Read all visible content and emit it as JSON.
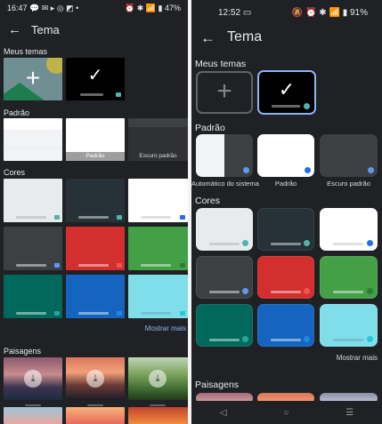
{
  "left": {
    "status": {
      "time": "16:47",
      "left_icons": "💬 ✉ ▸ ◎ ◩ •",
      "right_icons": "⏰ ✱ 📶 ▮",
      "battery": "47%"
    },
    "appbar": {
      "back": "←",
      "title": "Tema"
    },
    "sections": {
      "my_themes": "Meus temas",
      "default": "Padrão",
      "colors": "Cores",
      "landscapes": "Paisagens"
    },
    "default_labels": [
      "Automático do sistema",
      "Padrão",
      "Escuro padrão"
    ],
    "more": "Mostrar mais",
    "download_glyph": "⤓"
  },
  "right": {
    "status": {
      "time": "12:52",
      "left_icons": "▭",
      "right_icons": "🔕 ⏰ ✱ 📶 ▮",
      "battery": "91%"
    },
    "appbar": {
      "back": "←",
      "title": "Tema"
    },
    "sections": {
      "my_themes": "Meus temas",
      "default": "Padrão",
      "colors": "Cores",
      "landscapes": "Paisagens"
    },
    "default_labels": [
      "Automático do sistema",
      "Padrão",
      "Escuro padrão"
    ],
    "more": "Mostrar mais",
    "nav": {
      "back": "◁",
      "home": "○",
      "menu": "☰"
    }
  },
  "plus_glyph": "+",
  "check_glyph": "✓",
  "colors": {
    "accent_link": "#8ab4f8",
    "color_themes": [
      {
        "name": "light-teal",
        "bg": "#e8eaed",
        "accent": "#4db6ac"
      },
      {
        "name": "dark-slate",
        "bg": "#263238",
        "accent": "#4db6ac"
      },
      {
        "name": "white-blue",
        "bg": "#ffffff",
        "accent": "#1a73e8"
      },
      {
        "name": "dark-gray",
        "bg": "#3c4043",
        "accent": "#5e97f6"
      },
      {
        "name": "red",
        "bg": "#d32f2f",
        "accent": "#ef5350"
      },
      {
        "name": "green",
        "bg": "#43a047",
        "accent": "#2e7d32"
      },
      {
        "name": "dark-green",
        "bg": "#00695c",
        "accent": "#26a69a"
      },
      {
        "name": "blue",
        "bg": "#1565c0",
        "accent": "#1e88e5"
      },
      {
        "name": "cyan",
        "bg": "#80deea",
        "accent": "#26c6da"
      }
    ]
  }
}
